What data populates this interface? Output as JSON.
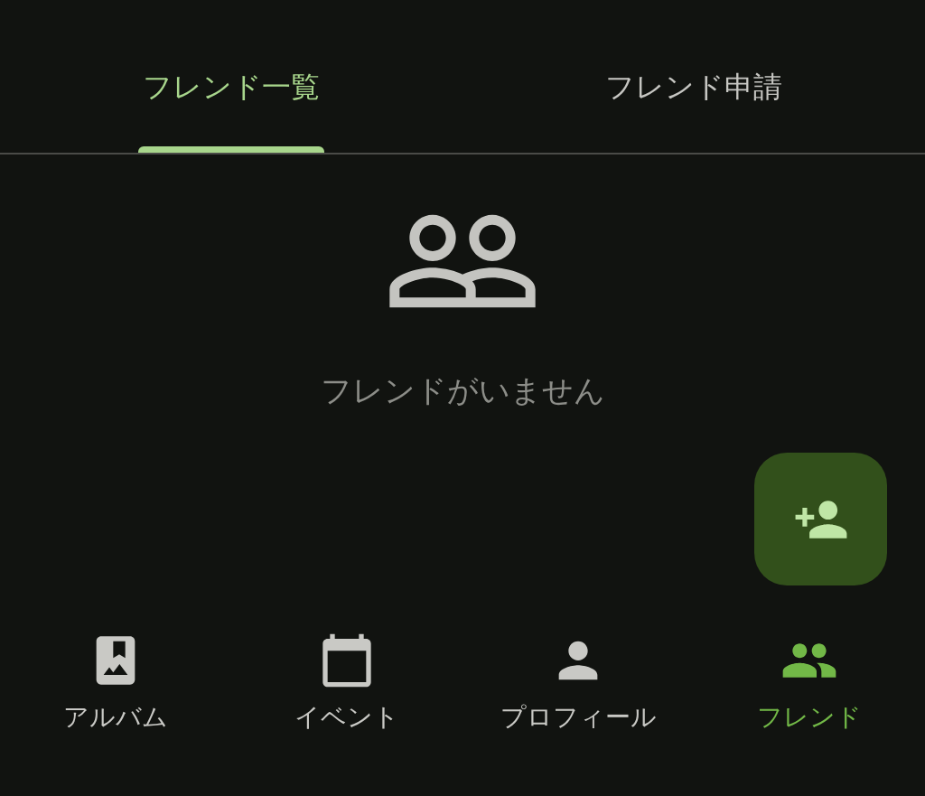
{
  "tabs": [
    {
      "label": "フレンド一覧",
      "selected": true
    },
    {
      "label": "フレンド申請",
      "selected": false
    }
  ],
  "empty_state": {
    "message": "フレンドがいません"
  },
  "bottom_nav": [
    {
      "label": "アルバム",
      "selected": false
    },
    {
      "label": "イベント",
      "selected": false
    },
    {
      "label": "プロフィール",
      "selected": false
    },
    {
      "label": "フレンド",
      "selected": true
    }
  ]
}
